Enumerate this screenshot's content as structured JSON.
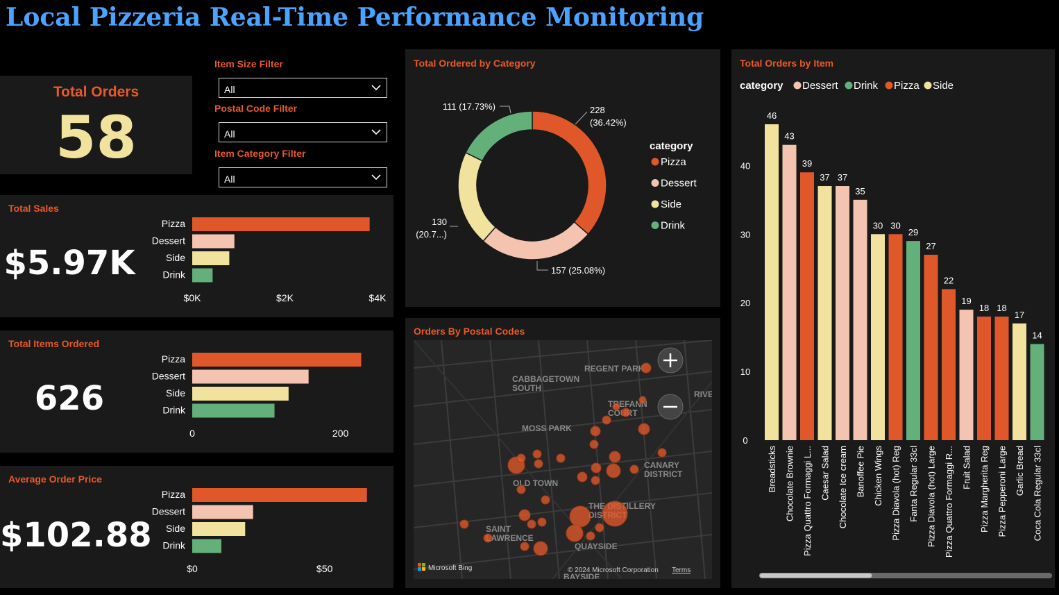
{
  "header": {
    "title": "Local Pizzeria Real-Time Performance Monitoring"
  },
  "colors": {
    "pizza": "#e0582a",
    "dessert": "#f4c4b0",
    "side": "#f1e39e",
    "drink": "#63b07b",
    "accent": "#e8592a",
    "title": "#4aa3ff"
  },
  "kpis": {
    "total_orders": {
      "label": "Total Orders",
      "value": "58"
    },
    "total_sales": {
      "label": "Total Sales",
      "value": "$5.97K"
    },
    "total_items": {
      "label": "Total Items Ordered",
      "value": "626"
    },
    "avg_price": {
      "label": "Average Order Price",
      "value": "$102.88"
    }
  },
  "filters": {
    "size": {
      "label": "Item Size Filter",
      "value": "All"
    },
    "postal": {
      "label": "Postal Code Filter",
      "value": "All"
    },
    "category": {
      "label": "Item Category Filter",
      "value": "All"
    }
  },
  "map": {
    "title": "Orders By Postal Codes",
    "places": [
      "CABBAGETOWN SOUTH",
      "REGENT PARK",
      "TREFANN COURT",
      "MOSS PARK",
      "CANARY DISTRICT",
      "OLD TOWN",
      "THE DISTILLERY DISTRICT",
      "SAINT LAWRENCE",
      "QUAYSIDE",
      "BAYSIDE",
      "RIVE"
    ],
    "bing_label": "Microsoft Bing",
    "copyright": "© 2024 Microsoft Corporation",
    "terms": "Terms"
  },
  "chart_data": [
    {
      "type": "bar",
      "orientation": "horizontal",
      "panel": "Total Sales",
      "categories": [
        "Pizza",
        "Dessert",
        "Side",
        "Drink"
      ],
      "values": [
        3830,
        910,
        800,
        440
      ],
      "xticks": [
        "$0K",
        "$2K",
        "$4K"
      ],
      "xlim": [
        0,
        4000
      ]
    },
    {
      "type": "bar",
      "orientation": "horizontal",
      "panel": "Total Items Ordered",
      "categories": [
        "Pizza",
        "Dessert",
        "Side",
        "Drink"
      ],
      "values": [
        228,
        157,
        130,
        111
      ],
      "xticks": [
        "0",
        "200"
      ],
      "xlim": [
        0,
        250
      ]
    },
    {
      "type": "bar",
      "orientation": "horizontal",
      "panel": "Average Order Price",
      "categories": [
        "Pizza",
        "Dessert",
        "Side",
        "Drink"
      ],
      "values": [
        66,
        23,
        20,
        11
      ],
      "xticks": [
        "$0",
        "$50"
      ],
      "xlim": [
        0,
        70
      ]
    },
    {
      "type": "pie",
      "donut": true,
      "title": "Total Ordered by Category",
      "legend_title": "category",
      "legend": [
        "Pizza",
        "Dessert",
        "Side",
        "Drink"
      ],
      "slices": [
        {
          "category": "Pizza",
          "value": 228,
          "label": "228 (36.42%)"
        },
        {
          "category": "Dessert",
          "value": 157,
          "label": "157 (25.08%)"
        },
        {
          "category": "Side",
          "value": 130,
          "label": "130 (20.7...)"
        },
        {
          "category": "Drink",
          "value": 111,
          "label": "111 (17.73%)"
        }
      ]
    },
    {
      "type": "bar",
      "title": "Total Orders by Item",
      "legend_title": "category",
      "legend": [
        "Dessert",
        "Drink",
        "Pizza",
        "Side"
      ],
      "categories": [
        "Breadsticks",
        "Chocolate Brownie",
        "Pizza Quattro Formaggi L...",
        "Caesar Salad",
        "Chocolate Ice cream",
        "Banoffee Pie",
        "Chicken Wings",
        "Pizza Diavola (hot) Reg",
        "Fanta Regular 33cl",
        "Pizza Diavola (hot) Large",
        "Pizza Quattro Formaggi R...",
        "Fruit Salad",
        "Pizza Margherita Reg",
        "Pizza Pepperoni Large",
        "Garlic Bread",
        "Coca Cola Regular 33cl"
      ],
      "values": [
        46,
        43,
        39,
        37,
        37,
        35,
        30,
        30,
        29,
        27,
        22,
        19,
        18,
        18,
        17,
        14
      ],
      "item_category": [
        "Side",
        "Dessert",
        "Pizza",
        "Side",
        "Dessert",
        "Dessert",
        "Side",
        "Pizza",
        "Drink",
        "Pizza",
        "Pizza",
        "Dessert",
        "Pizza",
        "Pizza",
        "Side",
        "Drink"
      ],
      "yticks": [
        "0",
        "10",
        "20",
        "30",
        "40"
      ],
      "ylim": [
        0,
        46
      ]
    }
  ]
}
